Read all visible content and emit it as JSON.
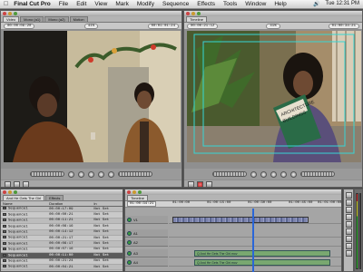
{
  "menubar": {
    "app_name": "Final Cut Pro",
    "items": [
      "File",
      "Edit",
      "View",
      "Mark",
      "Modify",
      "Sequence",
      "Effects",
      "Tools",
      "Window",
      "Help"
    ],
    "clock": "Tue 12:31 PM",
    "apple_icon": "apple-logo-icon"
  },
  "viewer": {
    "tabs": [
      "Video",
      "Mono (a1)",
      "Mono (a2)",
      "Motion"
    ],
    "timecode_left": "00:00:09:20",
    "timecode_right": "00:01:01:24",
    "zoom": "41%"
  },
  "canvas": {
    "title": "Timeline",
    "timecode_left": "00:00:21:12",
    "timecode_right": "01:00:34:21",
    "zoom": "41%",
    "book_title_line1": "ARCHITECTURE",
    "book_title_line2": "BUILDINGS"
  },
  "browser": {
    "tabs": [
      "And He Gets The Girl",
      "Effects"
    ],
    "columns": [
      "Name",
      "Duration",
      "In"
    ],
    "rows": [
      {
        "name": "Sequence1",
        "duration": "00:00:17:09",
        "in": "Not Set"
      },
      {
        "name": "Sequence1",
        "duration": "00:00:00:21",
        "in": "Not Set"
      },
      {
        "name": "Sequence1",
        "duration": "00:00:11:21",
        "in": "Not Set"
      },
      {
        "name": "Sequence1",
        "duration": "00:00:06:16",
        "in": "Not Set"
      },
      {
        "name": "Sequence1",
        "duration": "00:00:14:12",
        "in": "Not Set"
      },
      {
        "name": "Sequence1",
        "duration": "00:00:21:17",
        "in": "Not Set"
      },
      {
        "name": "Sequence1",
        "duration": "00:00:06:17",
        "in": "Not Set"
      },
      {
        "name": "Sequence1",
        "duration": "00:00:07:16",
        "in": "Not Set"
      },
      {
        "name": "Sequence1",
        "duration": "00:00:11:00",
        "in": "Not Set"
      },
      {
        "name": "Sequence1",
        "duration": "00:00:21:24",
        "in": "Not Set"
      },
      {
        "name": "Sequence1",
        "duration": "00:00:04:21",
        "in": "Not Set"
      }
    ],
    "selected_index": 8
  },
  "timeline": {
    "tab": "Timeline",
    "timecode": "01:00:34:21",
    "ruler": [
      "01:00:00",
      "01:00:15:00",
      "01:00:30:00",
      "01:00:45:00",
      "01:01:00:00"
    ],
    "tracks": [
      "V1",
      "A1",
      "A2",
      "A3",
      "A4"
    ],
    "audio_clip_label": "Q And He Gets The Girl.mov"
  },
  "colors": {
    "menubar": "#e6e6e6",
    "panel": "#8f8f8f",
    "accent_blue": "#2a66d8",
    "video_clip": "#8a8fb3",
    "audio_clip": "#79a870"
  }
}
